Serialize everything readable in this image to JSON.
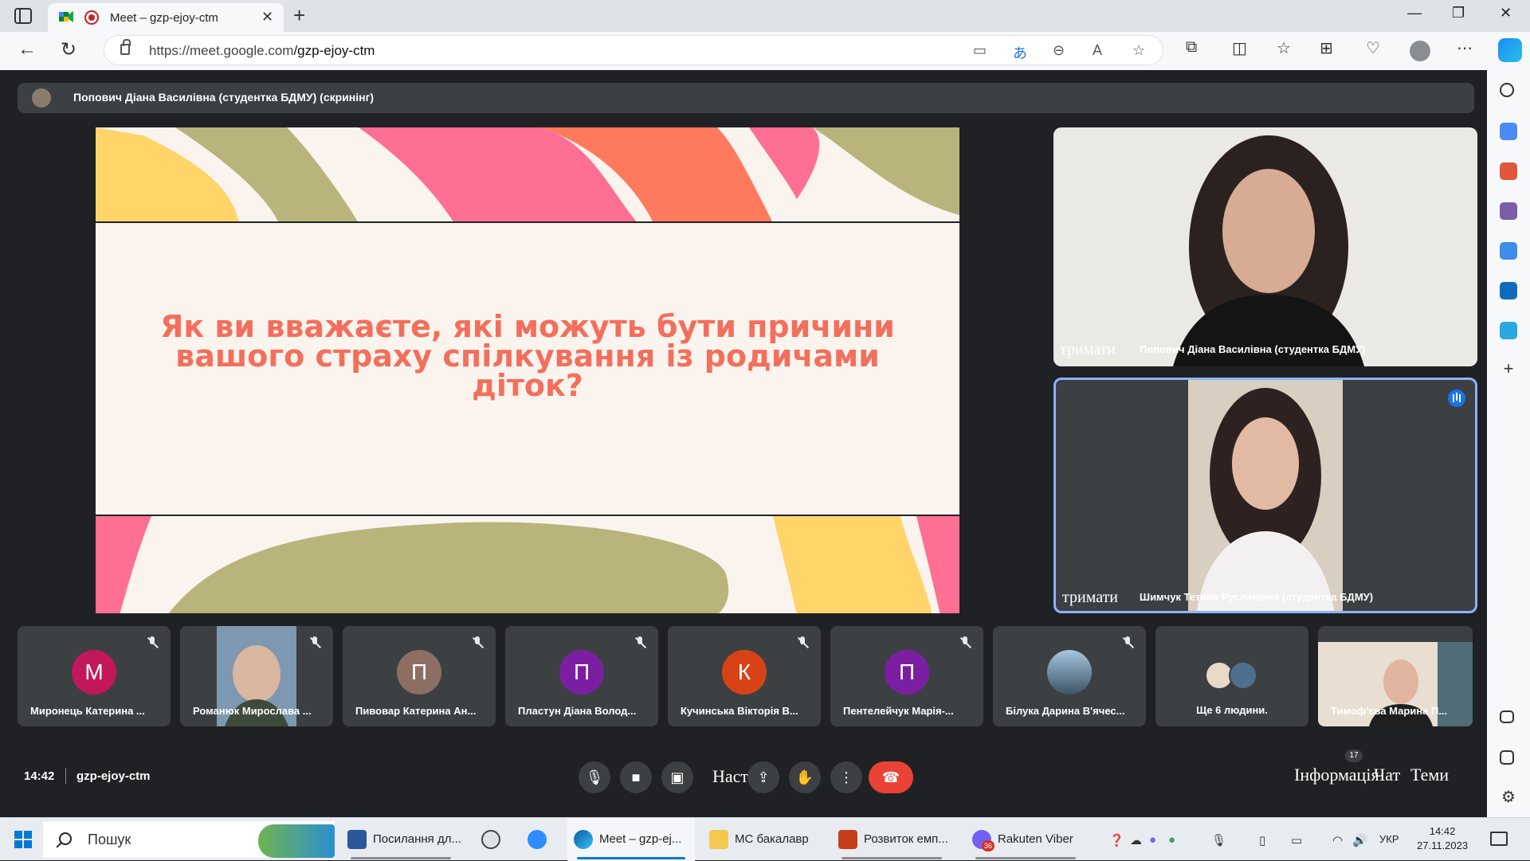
{
  "browser": {
    "tab_title": "Meet – gzp-ejoy-ctm",
    "url_host": "https://meet.google.com",
    "url_path": "/gzp-ejoy-ctm"
  },
  "meet": {
    "presenter_banner": "Попович Діана Василівна (студентка БДМУ) (скринінг)",
    "slide_text": "Як ви вважаєте, які можуть бути причини вашого страху спілкування із родичами діток?",
    "main_tiles": [
      {
        "name": "Попович Діана Василівна (студентка БДМУ)",
        "hold": "тримати"
      },
      {
        "name": "Шимчук Тетяна Русланівна (студентка БДМУ)",
        "hold": "тримати"
      }
    ],
    "participants": [
      {
        "initial": "М",
        "name": "Миронець Катерина ...",
        "color": "#c2185b"
      },
      {
        "initial": "",
        "name": "Романюк Мирослава ...",
        "color": "#6b7a86"
      },
      {
        "initial": "П",
        "name": "Пивовар Катерина Ан...",
        "color": "#8d6e63"
      },
      {
        "initial": "П",
        "name": "Пластун Діана Волод...",
        "color": "#7b1fa2"
      },
      {
        "initial": "К",
        "name": "Кучинська Вікторія В...",
        "color": "#d84315"
      },
      {
        "initial": "П",
        "name": "Пентелейчук Марія-...",
        "color": "#7b1fa2"
      },
      {
        "initial": "",
        "name": "Білука Дарина В'ячес...",
        "color": "#5b7f94"
      },
      {
        "initial": "",
        "name": "Ще 6 людини.",
        "color": "#3c4043"
      },
      {
        "initial": "",
        "name": "Тимоф'єва Марина П...",
        "color": "#cfc3b3"
      }
    ],
    "time": "14:42",
    "meeting_code": "gzp-ejoy-ctm",
    "present_caption": "Наст",
    "info_caption": "Інформація",
    "chat_caption": "Чат",
    "themes_caption": "Теми",
    "people_count": "17"
  },
  "taskbar": {
    "search_label": "Пошук",
    "apps": [
      {
        "label": "Посилання дл..."
      },
      {
        "label": ""
      },
      {
        "label": ""
      },
      {
        "label": "Meet – gzp-ej..."
      },
      {
        "label": "МС бакалавр"
      },
      {
        "label": "Розвиток емп..."
      },
      {
        "label": "Rakuten Viber"
      }
    ],
    "viber_badge": "36",
    "language": "УКР",
    "clock_time": "14:42",
    "clock_date": "27.11.2023"
  }
}
